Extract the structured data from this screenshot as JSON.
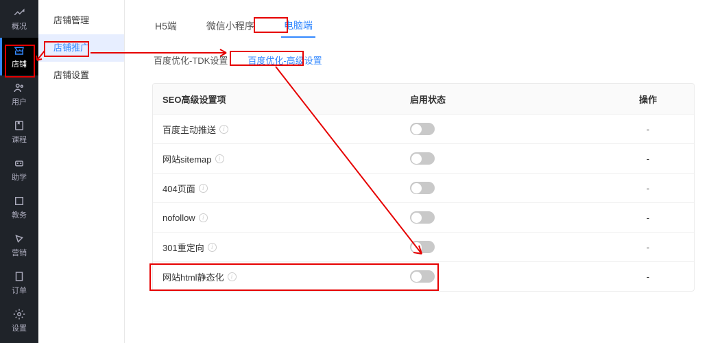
{
  "left_nav": [
    {
      "label": "概况",
      "icon": "overview-icon"
    },
    {
      "label": "店铺",
      "icon": "shop-icon",
      "active": true
    },
    {
      "label": "用户",
      "icon": "users-icon"
    },
    {
      "label": "课程",
      "icon": "course-icon"
    },
    {
      "label": "助学",
      "icon": "assist-icon"
    },
    {
      "label": "教务",
      "icon": "teach-icon"
    },
    {
      "label": "营销",
      "icon": "marketing-icon"
    },
    {
      "label": "订单",
      "icon": "order-icon"
    },
    {
      "label": "设置",
      "icon": "settings-icon"
    }
  ],
  "sub_nav": [
    {
      "label": "店铺管理"
    },
    {
      "label": "店铺推广",
      "active": true
    },
    {
      "label": "店铺设置"
    }
  ],
  "tabs": [
    {
      "label": "H5端"
    },
    {
      "label": "微信小程序"
    },
    {
      "label": "电脑端",
      "active": true
    }
  ],
  "sub_tabs": [
    {
      "label": "百度优化-TDK设置"
    },
    {
      "label": "百度优化-高级设置",
      "active": true
    }
  ],
  "table": {
    "headers": {
      "col1": "SEO高级设置项",
      "col2": "启用状态",
      "col3": "操作"
    },
    "rows": [
      {
        "label": "百度主动推送",
        "enabled": false,
        "op": "-"
      },
      {
        "label": "网站sitemap",
        "enabled": false,
        "op": "-"
      },
      {
        "label": "404页面",
        "enabled": false,
        "op": "-"
      },
      {
        "label": "nofollow",
        "enabled": false,
        "op": "-"
      },
      {
        "label": "301重定向",
        "enabled": false,
        "op": "-"
      },
      {
        "label": "网站html静态化",
        "enabled": false,
        "op": "-"
      }
    ]
  }
}
